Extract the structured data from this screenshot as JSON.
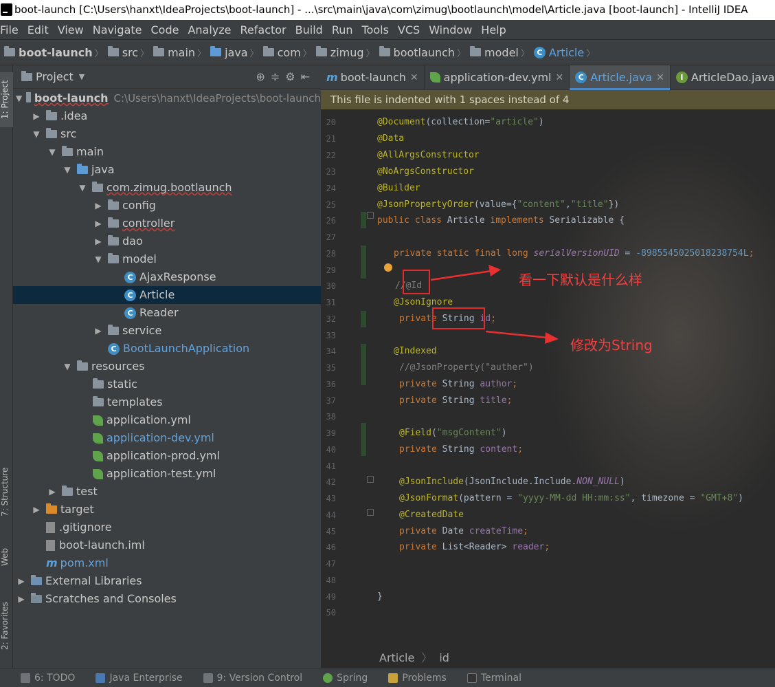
{
  "window": {
    "title": "boot-launch [C:\\Users\\hanxt\\IdeaProjects\\boot-launch] - ...\\src\\main\\java\\com\\zimug\\bootlaunch\\model\\Article.java [boot-launch] - IntelliJ IDEA"
  },
  "menu": [
    "File",
    "Edit",
    "View",
    "Navigate",
    "Code",
    "Analyze",
    "Refactor",
    "Build",
    "Run",
    "Tools",
    "VCS",
    "Window",
    "Help"
  ],
  "breadcrumbs": [
    "boot-launch",
    "src",
    "main",
    "java",
    "com",
    "zimug",
    "bootlaunch",
    "model",
    "Article"
  ],
  "side_tabs": {
    "project": "1: Project",
    "structure": "7: Structure",
    "web": "Web",
    "favorites": "2: Favorites"
  },
  "project": {
    "header": "Project",
    "root_name": "boot-launch",
    "root_path": "C:\\Users\\hanxt\\IdeaProjects\\boot-launch",
    "items": [
      {
        "label": ".idea"
      },
      {
        "label": "src"
      },
      {
        "label": "main"
      },
      {
        "label": "java"
      },
      {
        "label": "com.zimug.bootlaunch"
      },
      {
        "label": "config"
      },
      {
        "label": "controller"
      },
      {
        "label": "dao"
      },
      {
        "label": "model"
      },
      {
        "label": "AjaxResponse"
      },
      {
        "label": "Article"
      },
      {
        "label": "Reader"
      },
      {
        "label": "service"
      },
      {
        "label": "BootLaunchApplication"
      },
      {
        "label": "resources"
      },
      {
        "label": "static"
      },
      {
        "label": "templates"
      },
      {
        "label": "application.yml"
      },
      {
        "label": "application-dev.yml"
      },
      {
        "label": "application-prod.yml"
      },
      {
        "label": "application-test.yml"
      },
      {
        "label": "test"
      },
      {
        "label": "target"
      },
      {
        "label": ".gitignore"
      },
      {
        "label": "boot-launch.iml"
      },
      {
        "label": "pom.xml"
      },
      {
        "label": "External Libraries"
      },
      {
        "label": "Scratches and Consoles"
      }
    ]
  },
  "editor": {
    "tabs": [
      "boot-launch",
      "application-dev.yml",
      "Article.java",
      "ArticleDao.java"
    ],
    "active_tab": "Article.java",
    "banner": "This file is indented with 1 spaces instead of 4",
    "line_numbers": [
      "20",
      "21",
      "22",
      "23",
      "24",
      "25",
      "26",
      "27",
      "28",
      "29",
      "30",
      "31",
      "32",
      "33",
      "34",
      "35",
      "36",
      "37",
      "38",
      "39",
      "40",
      "41",
      "42",
      "43",
      "44",
      "45",
      "46",
      "47",
      "48",
      "49",
      "50"
    ],
    "code": {
      "l20a": "@Document",
      "l20b": "(collection=",
      "l20c": "\"article\"",
      "l20d": ")",
      "l21": "@Data",
      "l22": "@AllArgsConstructor",
      "l23": "@NoArgsConstructor",
      "l24": "@Builder",
      "l25a": "@JsonPropertyOrder",
      "l25b": "(value={",
      "l25c": "\"content\"",
      "l25d": ",",
      "l25e": "\"title\"",
      "l25f": "})",
      "l26a": "public class ",
      "l26b": "Article ",
      "l26c": "implements ",
      "l26d": "Serializable {",
      "l28a": "private static final long ",
      "l28b": "serialVersionUID",
      "l28c": " = ",
      "l28d": "-8985545025018238754L",
      "l28e": ";",
      "l30": "//@Id",
      "l31": "@JsonIgnore",
      "l32a": "private ",
      "l32b": "String ",
      "l32c": "id",
      "l34": "@Indexed",
      "l35": "//@JsonProperty(\"auther\")",
      "l36a": "private ",
      "l36b": "String ",
      "l36c": "author",
      "l37a": "private ",
      "l37b": "String ",
      "l37c": "title",
      "l39a": "@Field",
      "l39b": "(",
      "l39c": "\"msgContent\"",
      "l39d": ")",
      "l40a": "private ",
      "l40b": "String ",
      "l40c": "content",
      "l42a": "@JsonInclude",
      "l42b": "(JsonInclude.Include.",
      "l42c": "NON_NULL",
      "l42d": ")",
      "l43a": "@JsonFormat",
      "l43b": "(pattern = ",
      "l43c": "\"yyyy-MM-dd HH:mm:ss\"",
      "l43d": ", timezone = ",
      "l43e": "\"GMT+8\"",
      "l43f": ")",
      "l44": "@CreatedDate",
      "l45a": "private ",
      "l45b": "Date ",
      "l45c": "createTime",
      "l46a": "private ",
      "l46b": "List<Reader> ",
      "l46c": "reader",
      "l49": "}",
      "semi": ";"
    },
    "annotations": [
      "看一下默认是什么样",
      "修改为String"
    ],
    "footer": [
      "Article",
      "id"
    ]
  },
  "status_bar": [
    "6: TODO",
    "Java Enterprise",
    "9: Version Control",
    "Spring",
    "Problems",
    "Terminal"
  ]
}
